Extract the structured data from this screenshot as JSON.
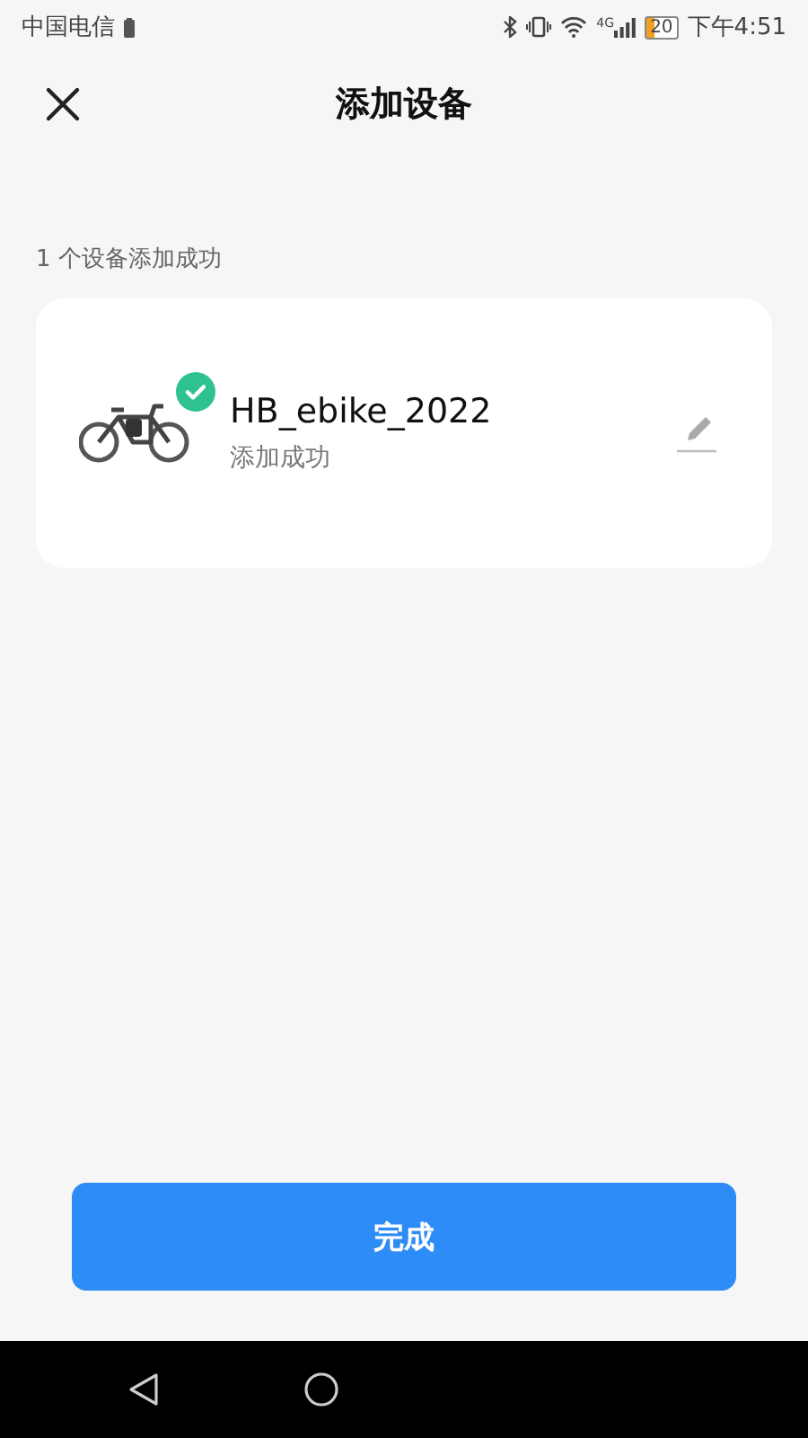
{
  "status_bar": {
    "carrier": "中国电信",
    "network": "4G",
    "battery": "20",
    "time": "下午4:51"
  },
  "header": {
    "title": "添加设备"
  },
  "summary": "1 个设备添加成功",
  "devices": [
    {
      "name": "HB_ebike_2022",
      "status": "添加成功",
      "added": true
    }
  ],
  "done_button": "完成"
}
